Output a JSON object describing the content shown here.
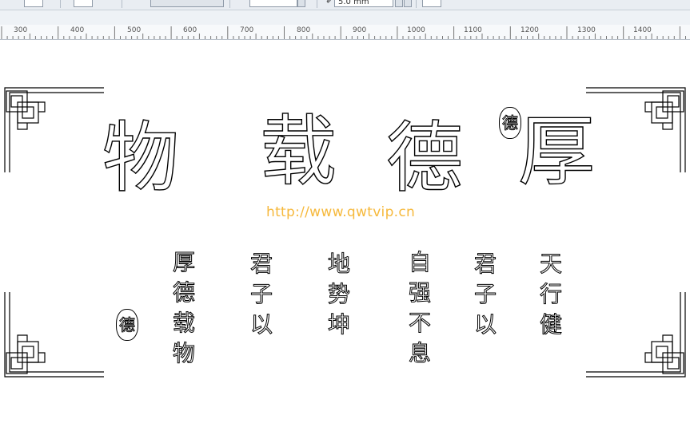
{
  "toolbar": {
    "outline_width": "5.0 mm",
    "outline_icon": "outline-pen-icon"
  },
  "ruler": {
    "ticks": [
      "300",
      "400",
      "500",
      "600",
      "700",
      "800",
      "900",
      "1000",
      "1100",
      "1200",
      "1300",
      "1400"
    ]
  },
  "artwork": {
    "main_chars": [
      "物",
      "载",
      "德",
      "厚"
    ],
    "seal_char": "德",
    "watermark": "http://www.qwtvip.cn",
    "columns": [
      {
        "chars": [
          "天",
          "行",
          "健"
        ]
      },
      {
        "chars": [
          "君",
          "子",
          "以"
        ]
      },
      {
        "chars": [
          "自",
          "强",
          "不",
          "息"
        ]
      },
      {
        "chars": [
          "地",
          "势",
          "坤"
        ]
      },
      {
        "chars": [
          "君",
          "子",
          "以"
        ]
      },
      {
        "chars": [
          "厚",
          "德",
          "载",
          "物"
        ]
      }
    ]
  }
}
